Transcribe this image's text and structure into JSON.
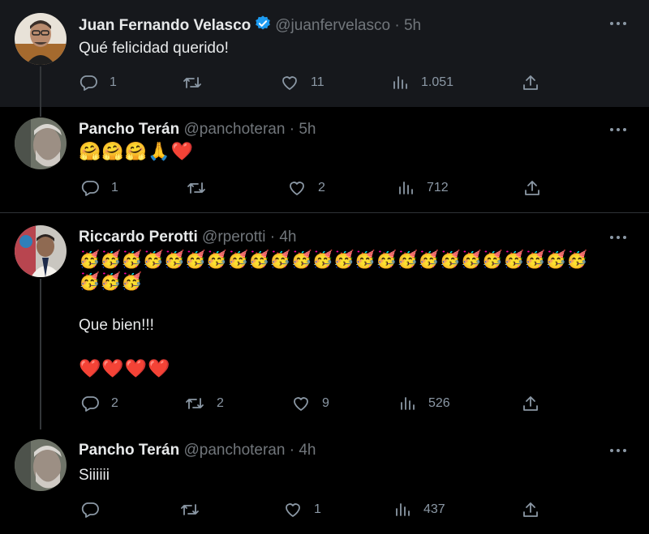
{
  "tweets": [
    {
      "name": "Juan Fernando Velasco",
      "verified": true,
      "handle": "@juanfervelasco",
      "dot": "·",
      "time": "5h",
      "text": "Qué felicidad querido!",
      "replies": "1",
      "retweets": "",
      "likes": "11",
      "views": "1.051"
    },
    {
      "name": "Pancho Terán",
      "handle": "@panchoteran",
      "dot": "·",
      "time": "5h",
      "emojis": "🤗🤗🤗🙏❤️",
      "replies": "1",
      "retweets": "",
      "likes": "2",
      "views": "712"
    },
    {
      "name": "Riccardo Perotti",
      "handle": "@rperotti",
      "dot": "·",
      "time": "4h",
      "emojis_line1": "🥳🥳🥳🥳🥳🥳🥳🥳🥳🥳🥳🥳🥳🥳🥳🥳🥳🥳🥳🥳🥳🥳🥳🥳",
      "emojis_line2": "🥳🥳🥳",
      "text": "Que bien!!!",
      "hearts": "❤️❤️❤️❤️",
      "replies": "2",
      "retweets": "2",
      "likes": "9",
      "views": "526"
    },
    {
      "name": "Pancho Terán",
      "handle": "@panchoteran",
      "dot": "·",
      "time": "4h",
      "text": "Siiiiii",
      "replies": "",
      "retweets": "",
      "likes": "1",
      "views": "437"
    }
  ],
  "icons": {
    "reply": "reply-icon",
    "retweet": "retweet-icon",
    "like": "like-icon",
    "views": "views-icon",
    "share": "share-icon",
    "more": "more-icon",
    "verified": "verified-badge-icon"
  },
  "colors": {
    "background": "#000000",
    "highlight": "#16181c",
    "text": "#e7e9ea",
    "secondary": "#71767b",
    "verified": "#1d9bf0",
    "heart": "#f91880",
    "divider": "#2f3336"
  }
}
